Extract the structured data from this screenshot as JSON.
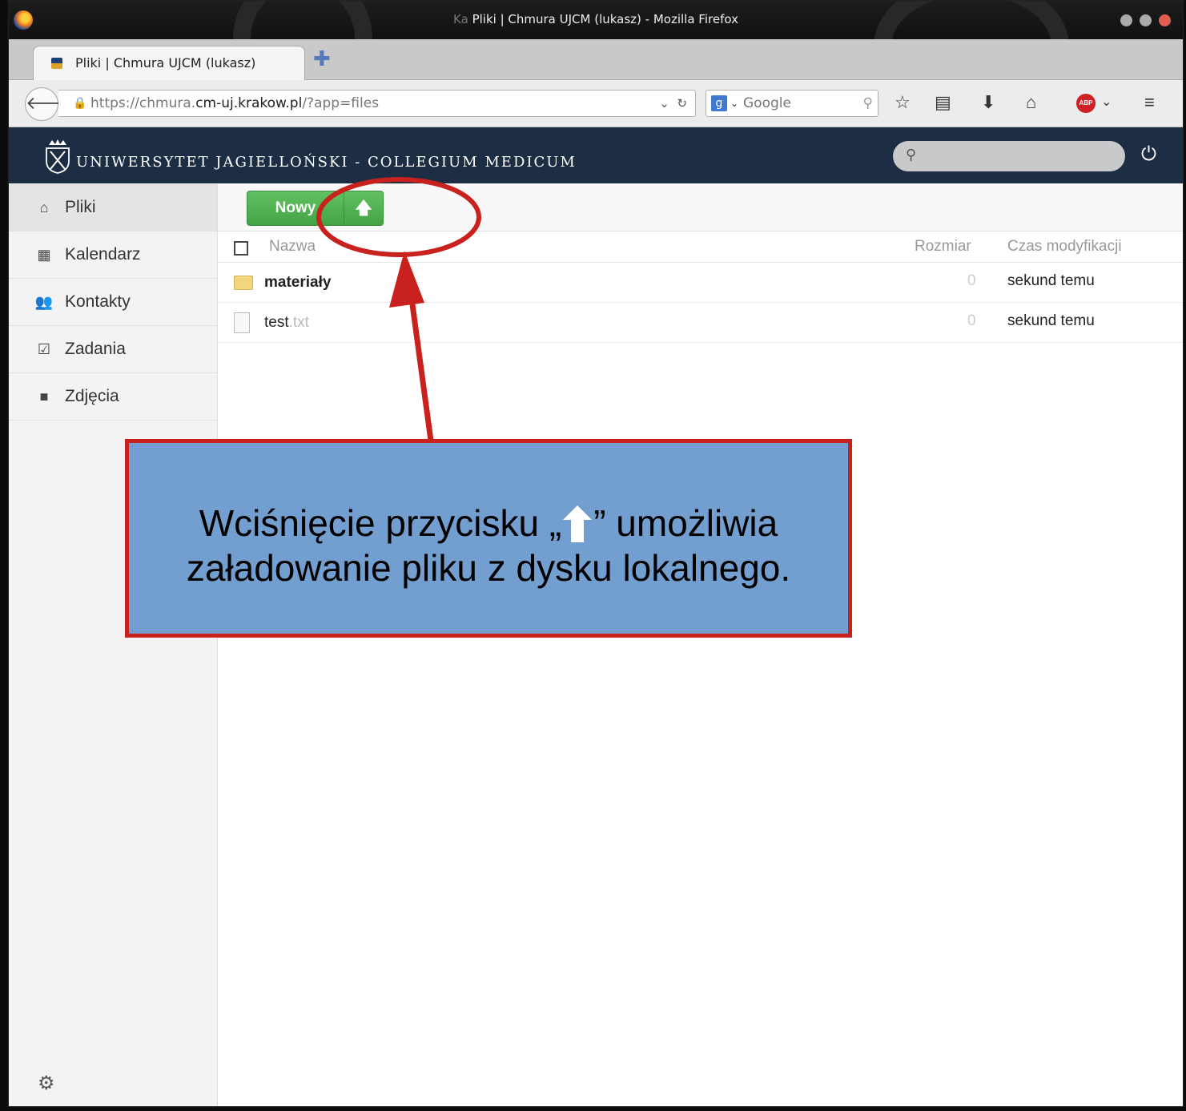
{
  "window": {
    "title_prefix": "Ka",
    "title": "Pliki | Chmura UJCM (lukasz) - Mozilla Firefox"
  },
  "tabs": [
    {
      "label": "Pliki | Chmura UJCM (lukasz)"
    }
  ],
  "navbar": {
    "url_prefix": "https://chmura.",
    "url_domain": "cm-uj.krakow.pl",
    "url_suffix": "/?app=files",
    "search_placeholder": "Google"
  },
  "header": {
    "brand": "UNIWERSYTET JAGIELLOŃSKI - COLLEGIUM MEDICUM"
  },
  "sidebar": {
    "items": [
      {
        "label": "Pliki",
        "icon": "home-icon"
      },
      {
        "label": "Kalendarz",
        "icon": "calendar-icon"
      },
      {
        "label": "Kontakty",
        "icon": "contacts-icon"
      },
      {
        "label": "Zadania",
        "icon": "tasks-icon"
      },
      {
        "label": "Zdjęcia",
        "icon": "photos-icon"
      }
    ]
  },
  "controls": {
    "new_label": "Nowy"
  },
  "table": {
    "columns": {
      "name": "Nazwa",
      "size": "Rozmiar",
      "modified": "Czas modyfikacji"
    },
    "rows": [
      {
        "name": "materiały",
        "ext": "",
        "size": "0",
        "modified": "sekund temu",
        "type": "folder"
      },
      {
        "name": "test",
        "ext": ".txt",
        "size": "0",
        "modified": "sekund temu",
        "type": "file"
      }
    ]
  },
  "annotation": {
    "line1_before": "Wciśnięcie przycisku „",
    "line1_after": "” umożliwia",
    "line2": "załadowanie pliku z dysku lokalnego."
  },
  "colors": {
    "header_bg": "#1d2d44",
    "button_green": "#4caf50",
    "callout_bg": "#729fcf",
    "annotation_red": "#c9211e"
  }
}
